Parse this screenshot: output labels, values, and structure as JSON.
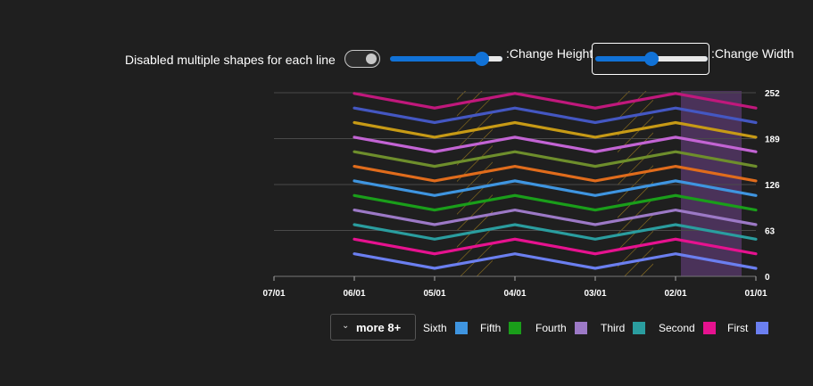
{
  "controls": {
    "toggle_label": "Disabled multiple shapes for each line",
    "height_label": ":Change Height",
    "width_label": ":Change Width",
    "height_slider_level": 0.82,
    "width_slider_level": 0.5
  },
  "legend": {
    "more_label": "more 8+",
    "more_icon": "chevron-down-icon"
  },
  "chart_data": {
    "type": "line",
    "x": [
      "01/01",
      "02/01",
      "03/01",
      "04/01",
      "05/01",
      "06/01",
      "07/01"
    ],
    "x_tick_labels": [
      "07/01",
      "06/01",
      "05/01",
      "04/01",
      "03/01",
      "02/01",
      "01/01"
    ],
    "x_axis_reversed": true,
    "y_axis_position": "right",
    "y_ticks": [
      "0",
      "63",
      "126",
      "189",
      "252"
    ],
    "ylim": [
      0,
      252
    ],
    "grid": true,
    "legend_position": "bottom",
    "hatched_bands": [
      [
        "02/01",
        "03/01"
      ],
      [
        "04/01",
        "05/01"
      ]
    ],
    "highlight_band": {
      "from": "01/01",
      "to": "02/01",
      "color": "#5a3a6e"
    },
    "series": [
      {
        "name": "First",
        "color": "#6b7ff0",
        "values": [
          11,
          31,
          11,
          31,
          11,
          31,
          null
        ]
      },
      {
        "name": "Second",
        "color": "#e6128f",
        "values": [
          31,
          51,
          31,
          51,
          31,
          51,
          null
        ]
      },
      {
        "name": "Third",
        "color": "#2a9d9f",
        "values": [
          51,
          71,
          51,
          71,
          51,
          71,
          null
        ]
      },
      {
        "name": "Fourth",
        "color": "#9c79c6",
        "values": [
          71,
          91,
          71,
          91,
          71,
          91,
          null
        ]
      },
      {
        "name": "Fifth",
        "color": "#1a9e1a",
        "values": [
          91,
          111,
          91,
          111,
          91,
          111,
          null
        ]
      },
      {
        "name": "Sixth",
        "color": "#3f95e0",
        "values": [
          111,
          131,
          111,
          131,
          111,
          131,
          null
        ]
      },
      {
        "color": "#e06c1c",
        "values": [
          131,
          151,
          131,
          151,
          131,
          151,
          null
        ]
      },
      {
        "color": "#6e8e2c",
        "values": [
          151,
          171,
          151,
          171,
          151,
          171,
          null
        ]
      },
      {
        "color": "#c364d4",
        "values": [
          171,
          191,
          171,
          191,
          171,
          191,
          null
        ]
      },
      {
        "color": "#c79a16",
        "values": [
          191,
          211,
          191,
          211,
          191,
          211,
          null
        ]
      },
      {
        "color": "#4457c2",
        "values": [
          211,
          231,
          211,
          231,
          211,
          231,
          null
        ]
      },
      {
        "color": "#c0187c",
        "values": [
          231,
          251,
          231,
          251,
          231,
          251,
          null
        ]
      }
    ]
  }
}
